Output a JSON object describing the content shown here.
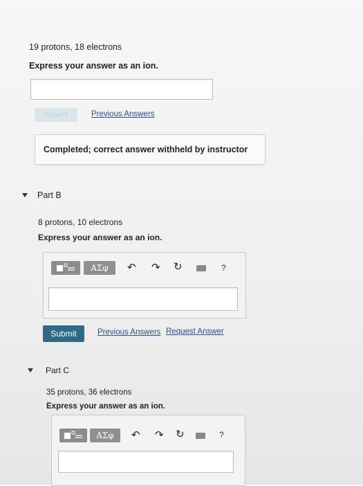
{
  "part_a": {
    "question": "19 protons, 18 electrons",
    "instruction": "Express your answer as an ion.",
    "submit_label": "Submit",
    "previous_answers": "Previous Answers",
    "status": "Completed; correct answer withheld by instructor"
  },
  "part_b": {
    "title": "Part B",
    "question": "8 protons, 10 electrons",
    "instruction": "Express your answer as an ion.",
    "toolbar": {
      "greek_label": "ΑΣφ",
      "help": "?"
    },
    "submit_label": "Submit",
    "previous_answers": "Previous Answers",
    "request_answer": "Request Answer"
  },
  "part_c": {
    "title": "Part C",
    "question": "35 protons, 36 electrons",
    "instruction": "Express your answer as an ion.",
    "toolbar": {
      "greek_label": "ΑΣφ",
      "help": "?"
    }
  },
  "icons": {
    "undo": "undo-icon",
    "redo": "redo-icon",
    "reset": "reset-icon",
    "keyboard": "keyboard-icon",
    "templates": "templates-icon",
    "collapse": "collapse-triangle-icon"
  },
  "colors": {
    "submit_bg": "#2e6a86",
    "link": "#2a4f9c",
    "disabled_submit": "#dbe6ea"
  }
}
